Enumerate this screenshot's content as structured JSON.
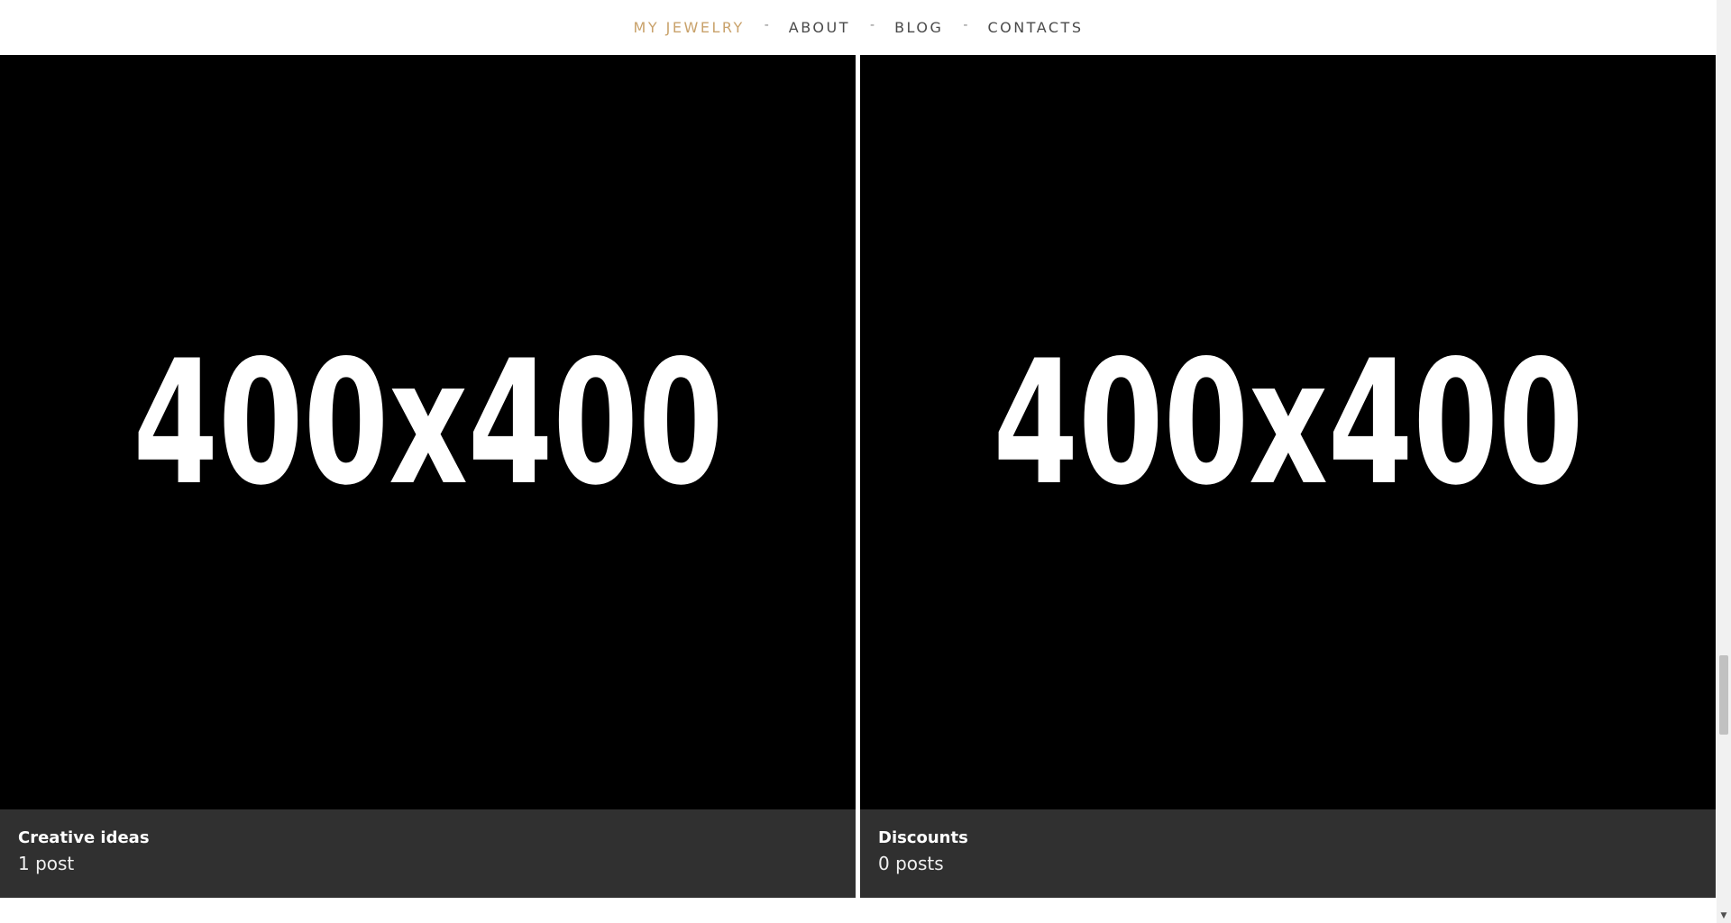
{
  "nav": {
    "items": [
      {
        "label": "MY JEWELRY",
        "active": true
      },
      {
        "label": "ABOUT",
        "active": false
      },
      {
        "label": "BLOG",
        "active": false
      },
      {
        "label": "CONTACTS",
        "active": false
      }
    ],
    "separator": "-",
    "active_color": "#c9a26b",
    "text_color": "#4a4a4a"
  },
  "categories": [
    {
      "image_text": "400x400",
      "title": "Creative ideas",
      "count": "1 post"
    },
    {
      "image_text": "400x400",
      "title": "Discounts",
      "count": "0 posts"
    }
  ],
  "colors": {
    "caption_bg": "#303030",
    "image_bg": "#000000"
  },
  "scrollbar": {
    "down_arrow_icon": "chevron-down-icon"
  }
}
